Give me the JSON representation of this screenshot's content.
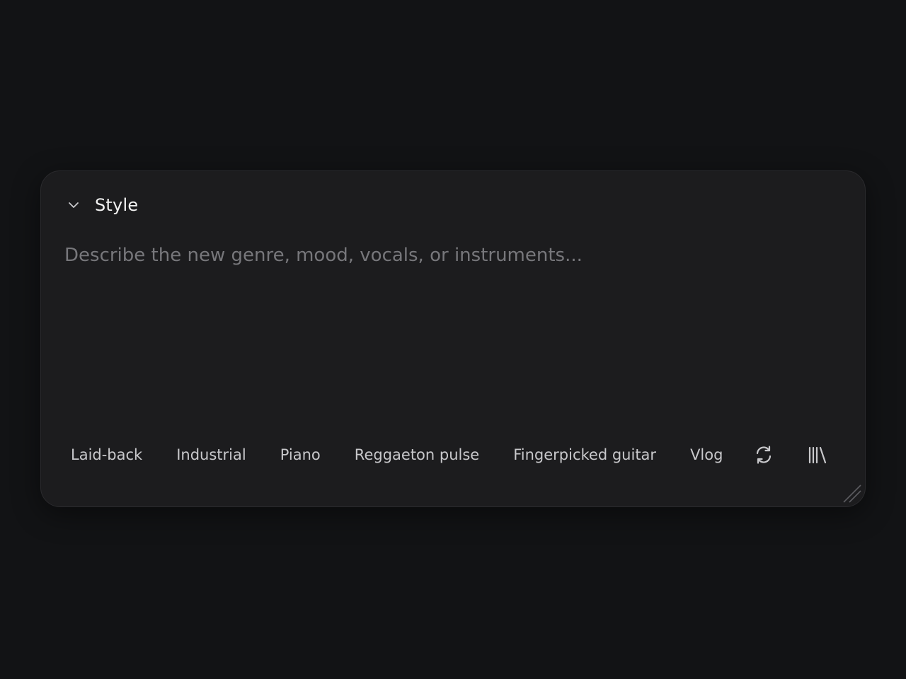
{
  "style_panel": {
    "title": "Style",
    "collapse_icon": "chevron-down-icon",
    "prompt": {
      "value": "",
      "placeholder": "Describe the new genre, mood, vocals, or instruments..."
    },
    "suggestions": [
      {
        "label": "Laid-back"
      },
      {
        "label": "Industrial"
      },
      {
        "label": "Piano"
      },
      {
        "label": "Reggaeton pulse"
      },
      {
        "label": "Fingerpicked guitar"
      },
      {
        "label": "Vlog"
      }
    ],
    "actions": {
      "refresh_icon": "refresh-icon",
      "library_icon": "library-icon"
    },
    "colors": {
      "background": "#121315",
      "panel": "#1c1c1e",
      "title_text": "#f2f2f2",
      "chip_text": "#c8c8cb",
      "placeholder_text": "#77777b"
    }
  }
}
